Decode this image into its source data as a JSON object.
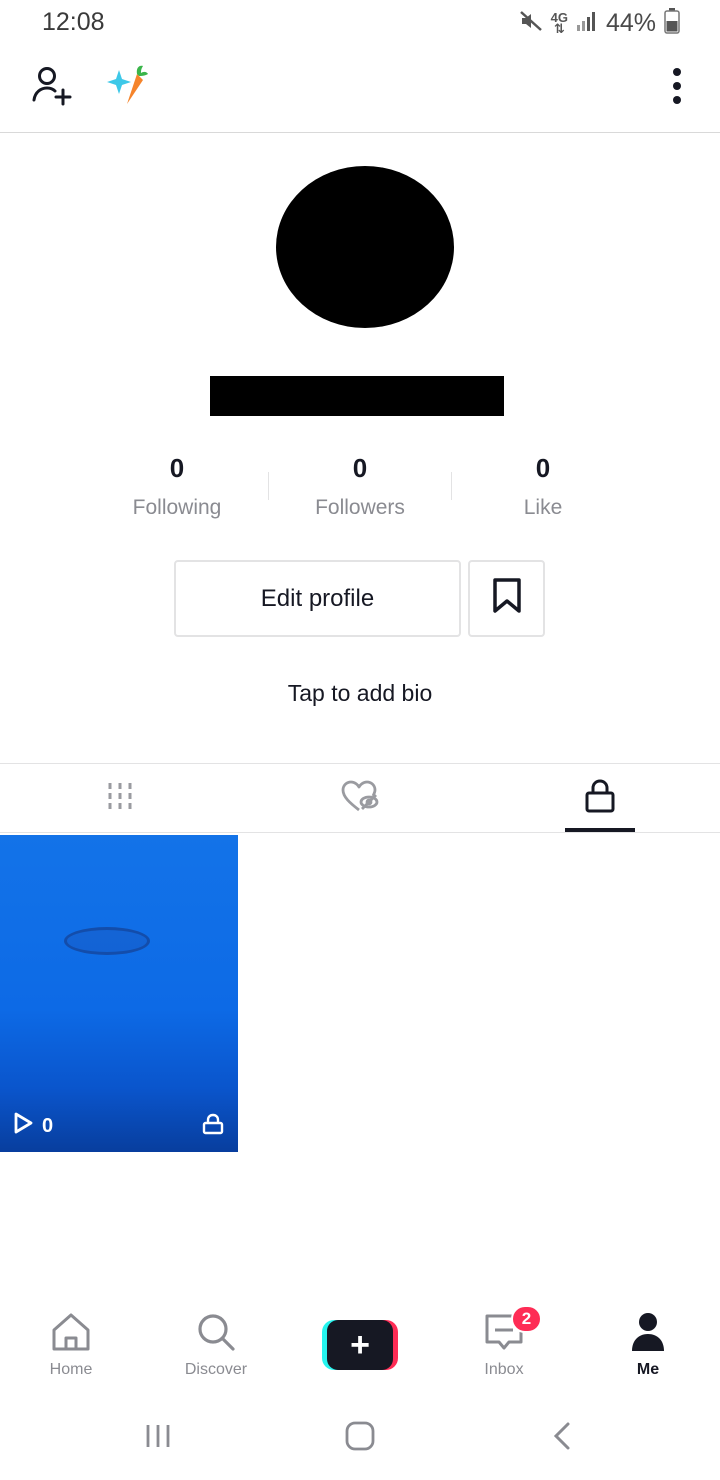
{
  "status_bar": {
    "time": "12:08",
    "network": "4G",
    "battery": "44%"
  },
  "top_bar": {
    "add_friend_icon": "person-add-icon",
    "sticker_icon": "sparkle-carrot-icon",
    "menu_icon": "more-vertical-icon"
  },
  "profile": {
    "stats": [
      {
        "count": "0",
        "label": "Following"
      },
      {
        "count": "0",
        "label": "Followers"
      },
      {
        "count": "0",
        "label": "Like"
      }
    ],
    "edit_label": "Edit profile",
    "bio": "Tap to add bio"
  },
  "tabs": [
    {
      "icon": "grid-icon",
      "active": false
    },
    {
      "icon": "hidden-likes-icon",
      "active": false
    },
    {
      "icon": "lock-icon",
      "active": true
    }
  ],
  "videos": [
    {
      "views": "0",
      "private": true
    }
  ],
  "bottom_nav": {
    "items": [
      {
        "label": "Home",
        "icon": "home-icon"
      },
      {
        "label": "Discover",
        "icon": "search-icon"
      },
      {
        "label": "",
        "icon": "plus-icon"
      },
      {
        "label": "Inbox",
        "icon": "inbox-icon"
      },
      {
        "label": "Me",
        "icon": "profile-icon"
      }
    ],
    "inbox_badge": "2"
  },
  "colors": {
    "accent": "#fe2c55",
    "accent2": "#25f4ee",
    "text": "#161823",
    "muted": "#8a8b91",
    "border": "#e3e3e4"
  }
}
